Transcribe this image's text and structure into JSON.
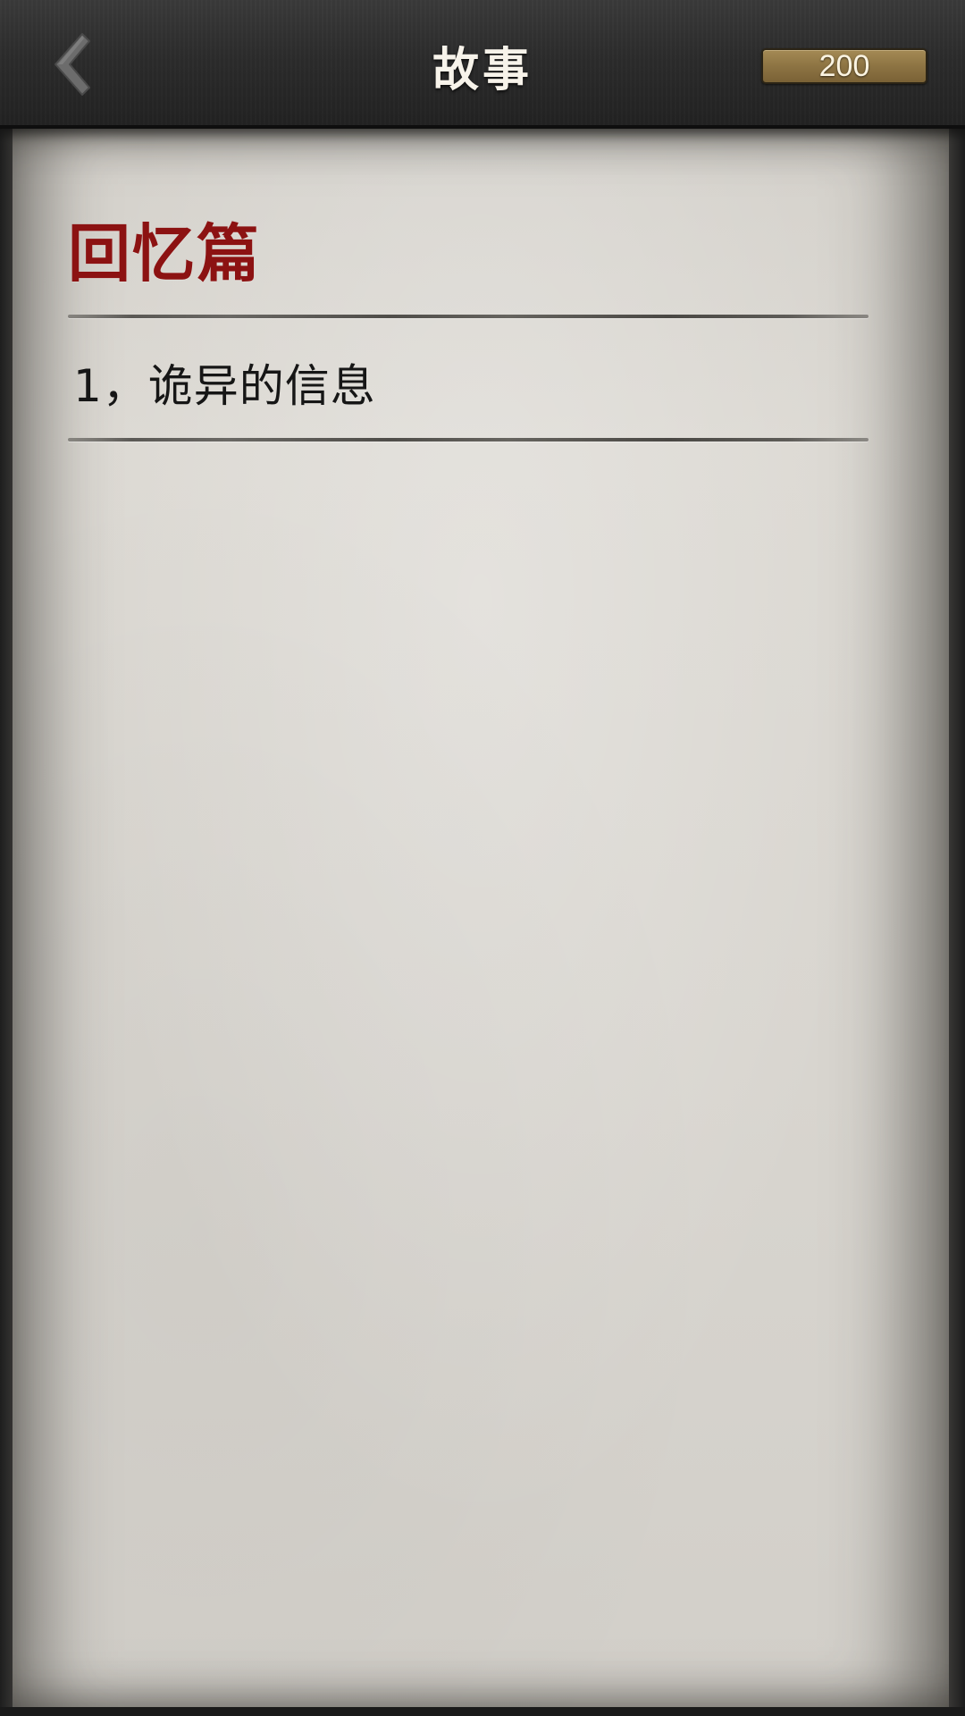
{
  "header": {
    "title": "故事",
    "currency_value": "200"
  },
  "story": {
    "section_title": "回忆篇",
    "chapters": [
      {
        "label": "1，诡异的信息"
      }
    ]
  },
  "colors": {
    "section_title": "#8c1212",
    "header_bg": "#2c2c2c",
    "paper": "#d8d5cf",
    "badge": "#8d7443"
  },
  "icons": {
    "back": "chevron-left-icon"
  }
}
